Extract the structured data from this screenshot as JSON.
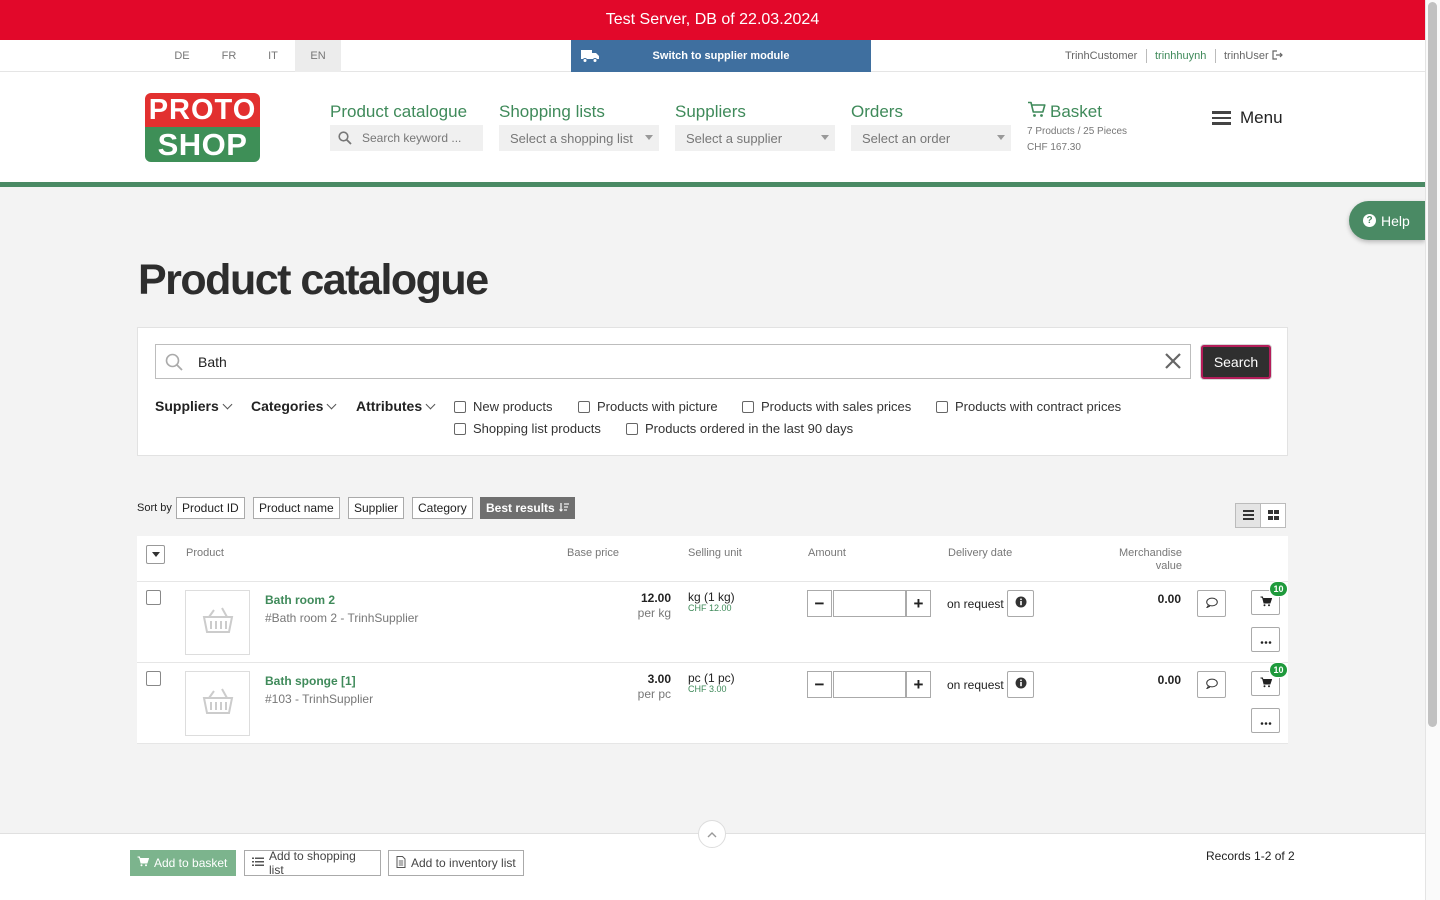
{
  "banner": {
    "text": "Test Server, DB of 22.03.2024"
  },
  "utilbar": {
    "languages": [
      "DE",
      "FR",
      "IT",
      "EN"
    ],
    "active_language": "EN",
    "switch_module": "Switch to supplier module",
    "users": [
      "TrinhCustomer",
      "trinhhuynh",
      "trinhUser"
    ]
  },
  "logo": {
    "line1": "PROTO",
    "line2": "SHOP"
  },
  "nav": {
    "catalogue": {
      "title": "Product catalogue",
      "placeholder": "Search keyword ..."
    },
    "shopping_lists": {
      "title": "Shopping lists",
      "placeholder": "Select a shopping list"
    },
    "suppliers": {
      "title": "Suppliers",
      "placeholder": "Select a supplier"
    },
    "orders": {
      "title": "Orders",
      "placeholder": "Select an order"
    },
    "basket": {
      "title": "Basket",
      "summary": "7 Products / 25 Pieces",
      "total": "CHF 167.30"
    },
    "menu": "Menu"
  },
  "help": "Help",
  "page_title": "Product catalogue",
  "search": {
    "value": "Bath",
    "button": "Search"
  },
  "filters": {
    "dropdowns": [
      "Suppliers",
      "Categories",
      "Attributes"
    ],
    "checkboxes": [
      "New products",
      "Products with picture",
      "Products with sales prices",
      "Products with contract prices",
      "Shopping list products",
      "Products ordered in the last 90 days"
    ]
  },
  "sort": {
    "label": "Sort by",
    "options": [
      "Product ID",
      "Product name",
      "Supplier",
      "Category",
      "Best results"
    ],
    "active": "Best results"
  },
  "table": {
    "headers": {
      "product": "Product",
      "base_price": "Base price",
      "selling_unit": "Selling unit",
      "amount": "Amount",
      "delivery_date": "Delivery date",
      "merch_line1": "Merchandise",
      "merch_line2": "value"
    },
    "rows": [
      {
        "name": "Bath room 2",
        "sub": "#Bath room 2 - TrinhSupplier",
        "price": "12.00",
        "per": "per kg",
        "unit": "kg (1 kg)",
        "unit_chf": "CHF 12.00",
        "delivery": "on request",
        "merch_value": "0.00",
        "badge": "10"
      },
      {
        "name": "Bath sponge [1]",
        "sub": "#103 - TrinhSupplier",
        "price": "3.00",
        "per": "per pc",
        "unit": "pc (1 pc)",
        "unit_chf": "CHF 3.00",
        "delivery": "on request",
        "merch_value": "0.00",
        "badge": "10"
      }
    ]
  },
  "bottom": {
    "add_basket": "Add to basket",
    "add_shopping_list": "Add to shopping list",
    "add_inventory_list": "Add to inventory list",
    "records": "Records 1-2 of 2"
  },
  "colors": {
    "banner": "#e2082a",
    "brand_green": "#3f8a5a",
    "supplier_blue": "#3f6f9f"
  }
}
